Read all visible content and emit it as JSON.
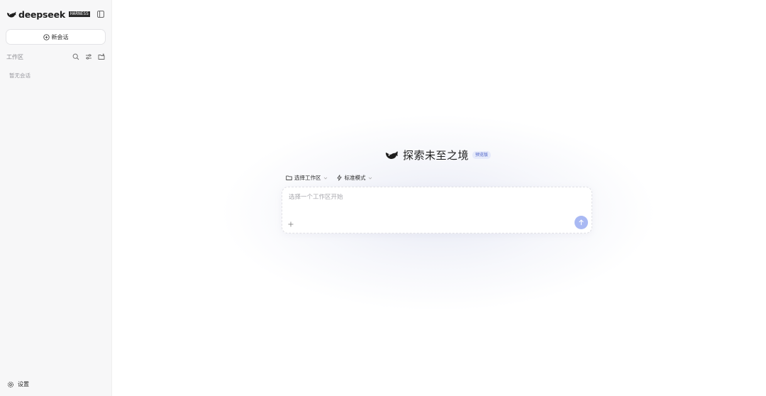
{
  "sidebar": {
    "brand": {
      "name": "deepseek",
      "badge": "HARNESS"
    },
    "new_chat_label": "新会话",
    "workspace_label": "工作区",
    "empty_label": "暂无会话",
    "settings_label": "设置"
  },
  "main": {
    "title": "探索未至之境",
    "badge": "预览版",
    "workspace_select_label": "选择工作区",
    "mode_select_label": "标准模式",
    "input_placeholder": "选择一个工作区开始"
  },
  "colors": {
    "sidebar_bg": "#f7f7f8",
    "accent": "#a9b9f3",
    "badge_bg": "#e7ebfb",
    "badge_text": "#4b61c6"
  },
  "icons": {
    "brand": "whale-logo-icon",
    "collapse": "sidebar-toggle-icon",
    "new_chat": "plus-circle-icon",
    "search": "search-icon",
    "filter": "sliders-icon",
    "new_folder": "folder-plus-icon",
    "settings": "gear-icon",
    "folder": "folder-icon",
    "mode": "bolt-icon",
    "chevron": "chevron-down-icon",
    "attach": "plus-icon",
    "send": "arrow-up-icon"
  }
}
